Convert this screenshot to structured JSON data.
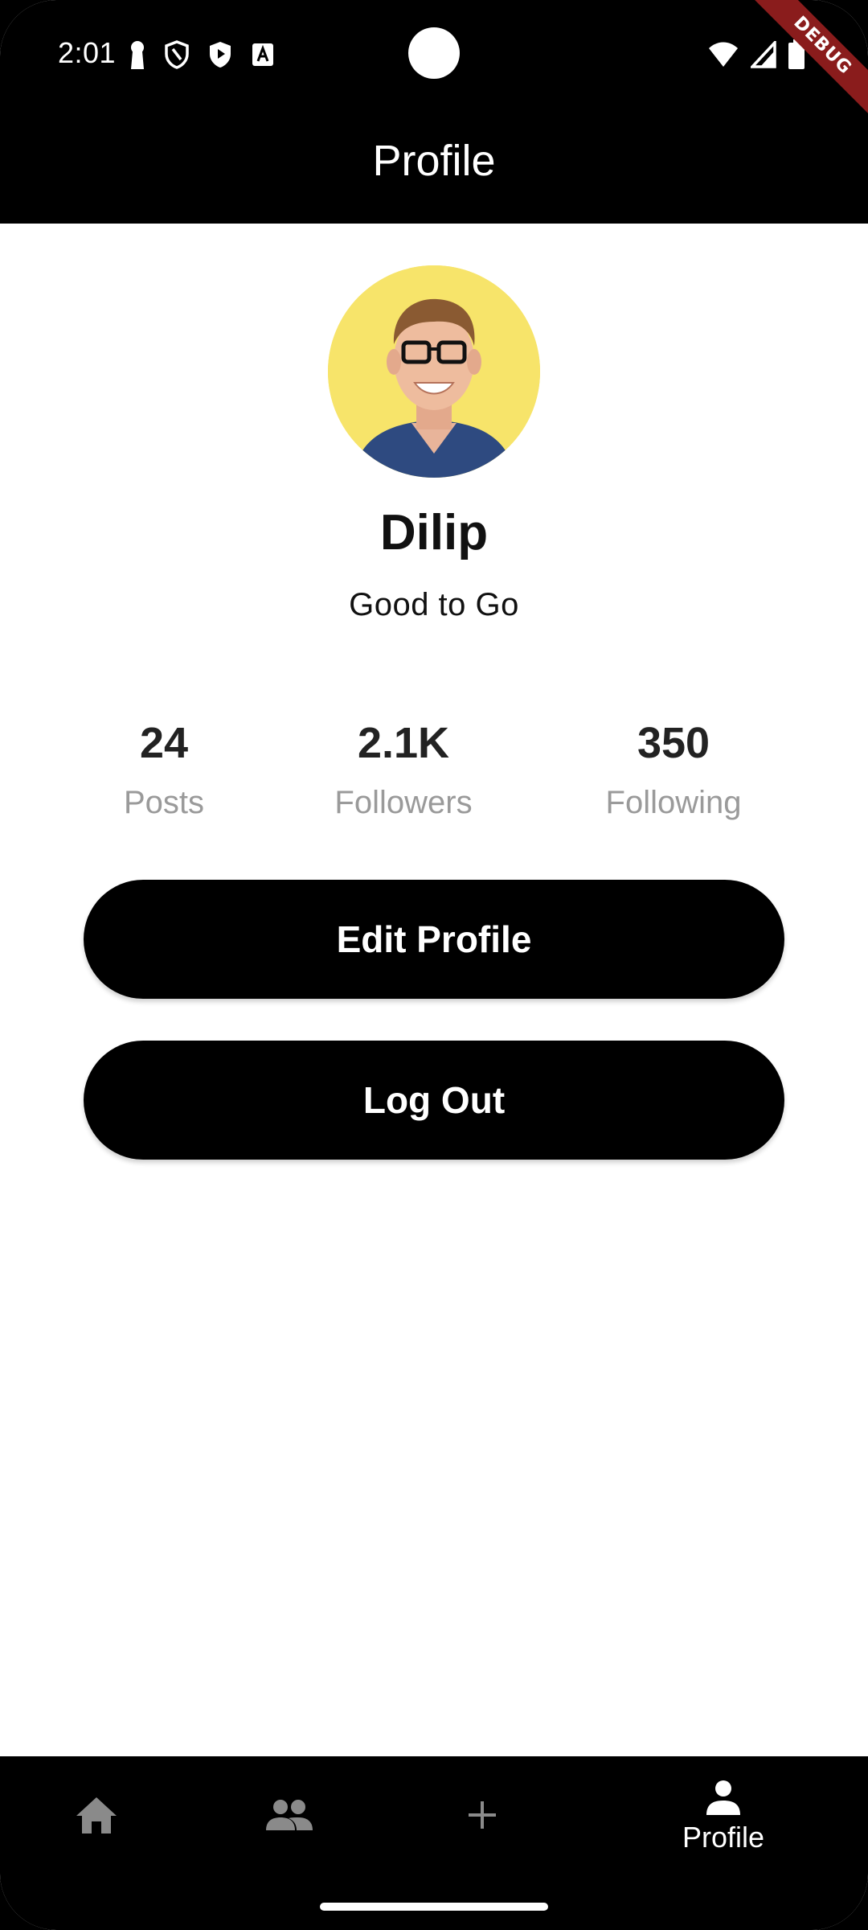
{
  "status_bar": {
    "time": "2:01",
    "left_icons": [
      "keyhole-icon",
      "shield-outline-icon",
      "shield-play-icon",
      "font-a-icon"
    ],
    "right_icons": [
      "wifi-icon",
      "cell-signal-icon",
      "battery-icon"
    ],
    "debug_banner": "DEBUG"
  },
  "app_bar": {
    "title": "Profile"
  },
  "profile": {
    "name": "Dilip",
    "status": "Good to Go",
    "avatar_bg_color": "#f7e46a"
  },
  "stats": [
    {
      "value": "24",
      "label": "Posts"
    },
    {
      "value": "2.1K",
      "label": "Followers"
    },
    {
      "value": "350",
      "label": "Following"
    }
  ],
  "actions": {
    "edit_profile": "Edit Profile",
    "log_out": "Log Out"
  },
  "bottom_nav": {
    "items": [
      {
        "icon": "home-icon",
        "label": ""
      },
      {
        "icon": "people-icon",
        "label": ""
      },
      {
        "icon": "add-icon",
        "label": ""
      },
      {
        "icon": "person-icon",
        "label": "Profile",
        "active": true
      }
    ],
    "active_color": "#ffffff",
    "inactive_color": "#8a8a8a"
  },
  "colors": {
    "primary": "#000000",
    "background": "#ffffff",
    "muted_text": "#9a9a9a",
    "debug_ribbon": "#8a1c1c"
  }
}
